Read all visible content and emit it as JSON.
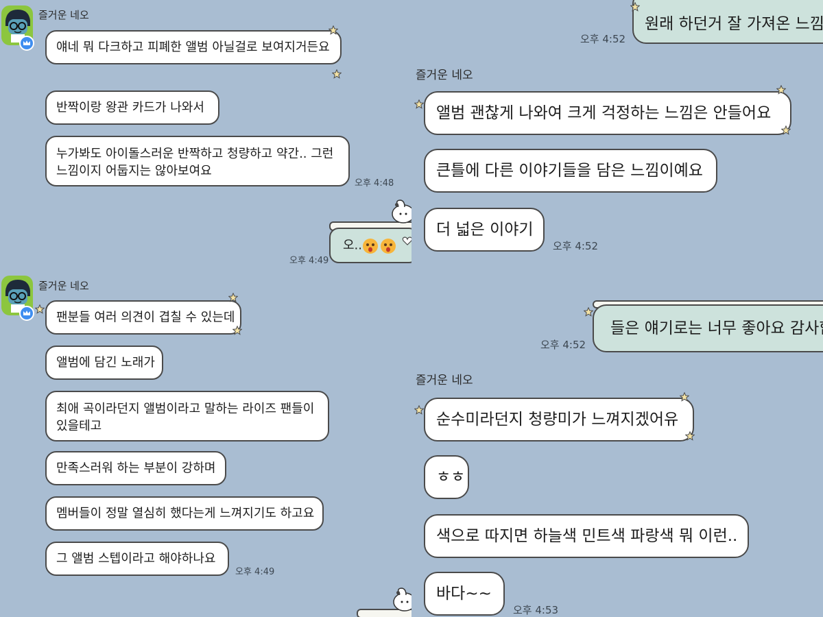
{
  "sender_name": "즐거운 네오",
  "panel_top_left": {
    "messages": [
      "얘네 뭐 다크하고 피폐한 앨범 아닐걸로 보여지거든요",
      "반짝이랑 왕관 카드가 나와서",
      "누가봐도 아이돌스러운 반짝하고 청량하고 약간.. 그런",
      "느낌이지 어둡지는 않아보여요"
    ],
    "time_received": "오후 4:48",
    "my_message": "오..",
    "time_sent": "오후 4:49"
  },
  "panel_bottom_left": {
    "messages": [
      "팬분들 여러 의견이 겹칠 수 있는데",
      "앨범에 담긴 노래가",
      "최애 곡이라던지 앨범이라고 말하는 라이즈 팬들이",
      "있을테고",
      "만족스러워 하는 부분이 강하며",
      "멤버들이 정말 열심히 했다는게 느껴지기도 하고요",
      "그 앨범 스텝이라고 해야하나요"
    ],
    "time_received": "오후 4:49"
  },
  "panel_right_1": {
    "my_message": "원래 하던거 잘 가져온 느낌",
    "time_sent": "오후 4:52"
  },
  "panel_right_2": {
    "messages": [
      "앨범 괜찮게 나와여 크게 걱정하는 느낌은 안들어요",
      "큰틀에 다른 이야기들을 담은 느낌이예요",
      "더 넓은 이야기"
    ],
    "time_received": "오후 4:52"
  },
  "panel_right_3": {
    "my_message": "들은 얘기로는 너무 좋아요 감사합",
    "time_sent": "오후 4:52"
  },
  "panel_right_4": {
    "messages": [
      "순수미라던지 청량미가 느껴지겠어유",
      "ㅎㅎ",
      "색으로 따지면 하늘색 민트색 파랑색 뭐 이런..",
      "바다~~"
    ],
    "time_received": "오후 4:53"
  },
  "colors": {
    "background": "#a9bdd2",
    "bubble_received": "#ffffff",
    "bubble_sent": "#cde2dc",
    "bubble_border": "#4a4a4a",
    "star": "#f4e3a6"
  },
  "icons": [
    "neo-avatar-icon",
    "crown-badge-icon",
    "star-decoration-icon",
    "surprised-face-emoji",
    "pochacco-sticker-icon"
  ]
}
